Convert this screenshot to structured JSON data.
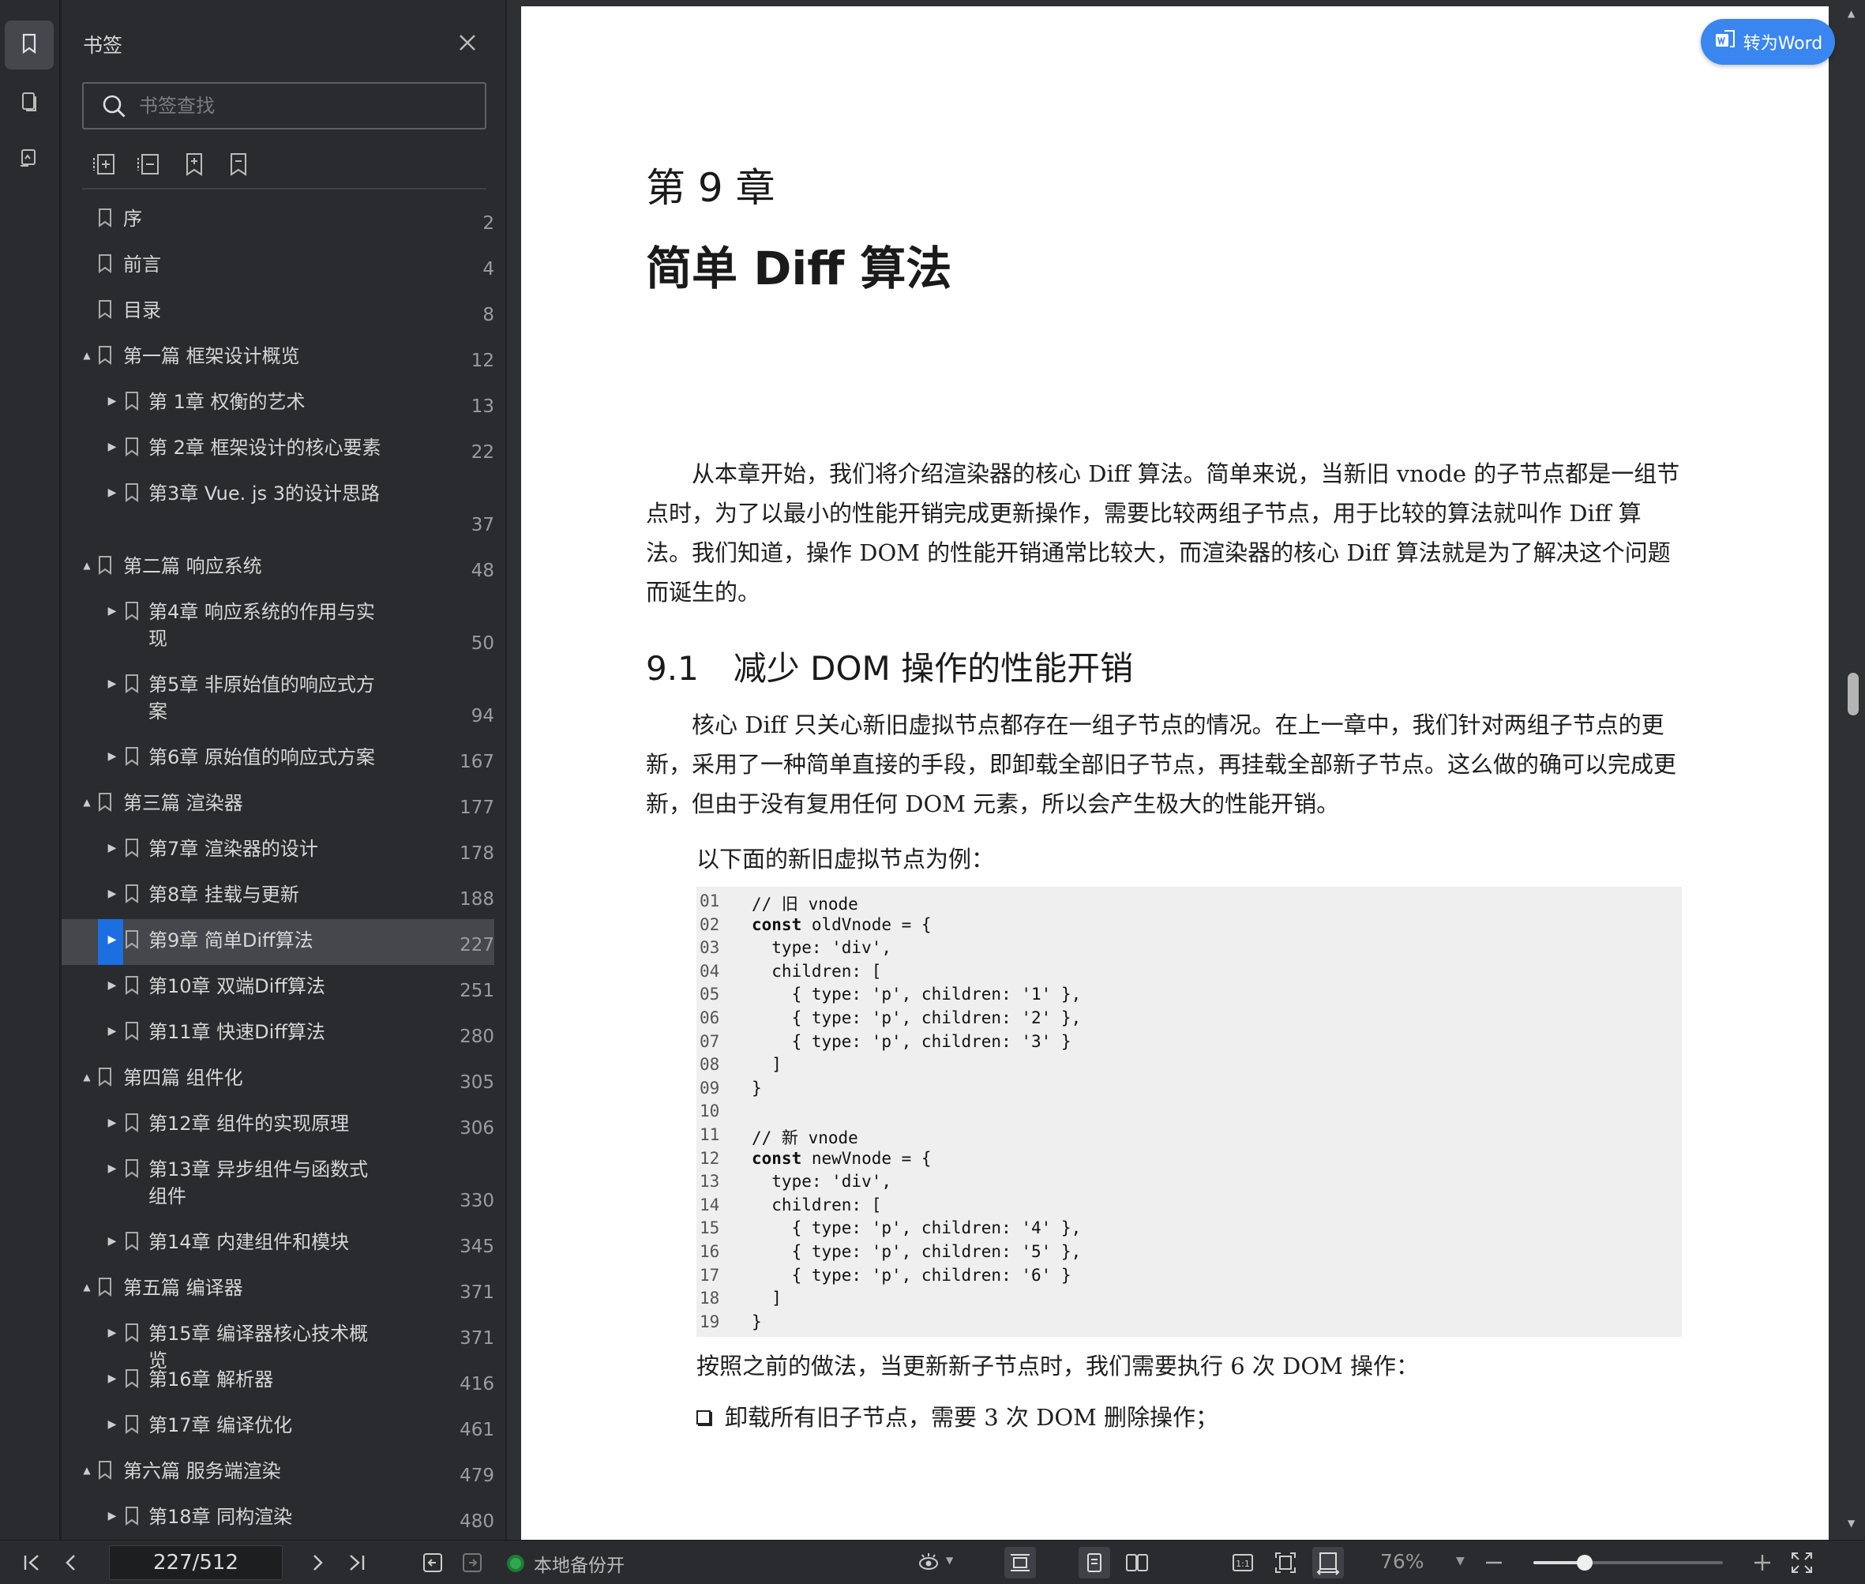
{
  "sidebar_rail": {
    "items": [
      {
        "name": "bookmark-icon",
        "active": true
      },
      {
        "name": "pages-icon",
        "active": false
      },
      {
        "name": "annotation-icon",
        "active": false
      }
    ]
  },
  "bookmarks": {
    "title": "书签",
    "search_placeholder": "书签查找",
    "items": [
      {
        "label": "序",
        "page": "2",
        "level": 0,
        "expander": ""
      },
      {
        "label": "前言",
        "page": "4",
        "level": 0,
        "expander": ""
      },
      {
        "label": "目录",
        "page": "8",
        "level": 0,
        "expander": ""
      },
      {
        "label": "第一篇 框架设计概览",
        "page": "12",
        "level": 0,
        "expander": "▲"
      },
      {
        "label": "第 1章 权衡的艺术",
        "page": "13",
        "level": 1,
        "expander": "▶"
      },
      {
        "label": "第 2章 框架设计的核心要素",
        "page": "22",
        "level": 1,
        "expander": "▶"
      },
      {
        "label": "第3章 Vue. js 3的设计思路",
        "page": "37",
        "level": 1,
        "expander": "▶",
        "tall": true
      },
      {
        "label": "第二篇 响应系统",
        "page": "48",
        "level": 0,
        "expander": "▲"
      },
      {
        "label": "第4章 响应系统的作用与实现",
        "page": "50",
        "level": 1,
        "expander": "▶",
        "tall": true
      },
      {
        "label": "第5章 非原始值的响应式方案",
        "page": "94",
        "level": 1,
        "expander": "▶",
        "tall": true
      },
      {
        "label": "第6章 原始值的响应式方案",
        "page": "167",
        "level": 1,
        "expander": "▶"
      },
      {
        "label": "第三篇 渲染器",
        "page": "177",
        "level": 0,
        "expander": "▲"
      },
      {
        "label": "第7章 渲染器的设计",
        "page": "178",
        "level": 1,
        "expander": "▶"
      },
      {
        "label": "第8章 挂载与更新",
        "page": "188",
        "level": 1,
        "expander": "▶"
      },
      {
        "label": "第9章 简单Diff算法",
        "page": "227",
        "level": 1,
        "expander": "▶",
        "selected": true
      },
      {
        "label": "第10章 双端Diff算法",
        "page": "251",
        "level": 1,
        "expander": "▶"
      },
      {
        "label": "第11章 快速Diff算法",
        "page": "280",
        "level": 1,
        "expander": "▶"
      },
      {
        "label": "第四篇 组件化",
        "page": "305",
        "level": 0,
        "expander": "▲"
      },
      {
        "label": "第12章 组件的实现原理",
        "page": "306",
        "level": 1,
        "expander": "▶"
      },
      {
        "label": "第13章 异步组件与函数式组件",
        "page": "330",
        "level": 1,
        "expander": "▶",
        "tall": true
      },
      {
        "label": "第14章 内建组件和模块",
        "page": "345",
        "level": 1,
        "expander": "▶"
      },
      {
        "label": "第五篇 编译器",
        "page": "371",
        "level": 0,
        "expander": "▲"
      },
      {
        "label": "第15章 编译器核心技术概览",
        "page": "371",
        "level": 1,
        "expander": "▶"
      },
      {
        "label": "第16章 解析器",
        "page": "416",
        "level": 1,
        "expander": "▶"
      },
      {
        "label": "第17章 编译优化",
        "page": "461",
        "level": 1,
        "expander": "▶"
      },
      {
        "label": "第六篇 服务端渲染",
        "page": "479",
        "level": 0,
        "expander": "▲"
      },
      {
        "label": "第18章 同构渲染",
        "page": "480",
        "level": 1,
        "expander": "▶"
      }
    ]
  },
  "document": {
    "convert_button": "转为Word",
    "chapter_number": "第 9 章",
    "chapter_title": "简单 Diff 算法",
    "para1": "从本章开始，我们将介绍渲染器的核心 Diff 算法。简单来说，当新旧 vnode 的子节点都是一组节点时，为了以最小的性能开销完成更新操作，需要比较两组子节点，用于比较的算法就叫作 Diff 算法。我们知道，操作 DOM 的性能开销通常比较大，而渲染器的核心 Diff 算法就是为了解决这个问题而诞生的。",
    "section_number": "9.1",
    "section_title": "减少 DOM 操作的性能开销",
    "para2": "核心 Diff 只关心新旧虚拟节点都存在一组子节点的情况。在上一章中，我们针对两组子节点的更新，采用了一种简单直接的手段，即卸载全部旧子节点，再挂载全部新子节点。这么做的确可以完成更新，但由于没有复用任何 DOM 元素，所以会产生极大的性能开销。",
    "lead": "以下面的新旧虚拟节点为例：",
    "code": [
      {
        "n": "01",
        "t": "// 旧 vnode"
      },
      {
        "n": "02",
        "t": "const oldVnode = {",
        "kw": "const"
      },
      {
        "n": "03",
        "t": "  type: 'div',"
      },
      {
        "n": "04",
        "t": "  children: ["
      },
      {
        "n": "05",
        "t": "    { type: 'p', children: '1' },"
      },
      {
        "n": "06",
        "t": "    { type: 'p', children: '2' },"
      },
      {
        "n": "07",
        "t": "    { type: 'p', children: '3' }"
      },
      {
        "n": "08",
        "t": "  ]"
      },
      {
        "n": "09",
        "t": "}"
      },
      {
        "n": "10",
        "t": ""
      },
      {
        "n": "11",
        "t": "// 新 vnode"
      },
      {
        "n": "12",
        "t": "const newVnode = {",
        "kw": "const"
      },
      {
        "n": "13",
        "t": "  type: 'div',"
      },
      {
        "n": "14",
        "t": "  children: ["
      },
      {
        "n": "15",
        "t": "    { type: 'p', children: '4' },"
      },
      {
        "n": "16",
        "t": "    { type: 'p', children: '5' },"
      },
      {
        "n": "17",
        "t": "    { type: 'p', children: '6' }"
      },
      {
        "n": "18",
        "t": "  ]"
      },
      {
        "n": "19",
        "t": "}"
      }
    ],
    "para3": "按照之前的做法，当更新新子节点时，我们需要执行 6 次 DOM 操作：",
    "bullet1": "卸载所有旧子节点，需要 3 次 DOM 删除操作；"
  },
  "statusbar": {
    "page_value": "227/512",
    "backup_label": "本地备份开",
    "zoom": "76%",
    "zoom_fraction": 0.27,
    "accent": "#1b6fe0",
    "backup_color": "#2fa84f"
  }
}
